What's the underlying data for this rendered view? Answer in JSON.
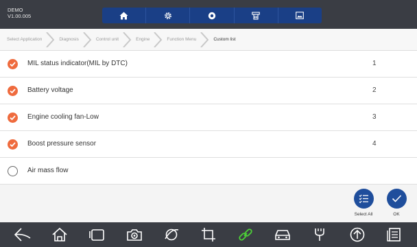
{
  "app": {
    "name": "DEMO",
    "version": "V1.00.005"
  },
  "toolbar": {
    "buttons": [
      {
        "icon": "home-icon"
      },
      {
        "icon": "gear-icon"
      },
      {
        "icon": "record-icon"
      },
      {
        "icon": "printer-icon"
      },
      {
        "icon": "image-icon"
      }
    ]
  },
  "breadcrumb": [
    "Select Application",
    "Diagnosis",
    "Control unit",
    "Engine",
    "Function Menu",
    "Custom list"
  ],
  "list": {
    "items": [
      {
        "label": "MIL status indicator(MIL by DTC)",
        "number": "1",
        "checked": true
      },
      {
        "label": "Battery voltage",
        "number": "2",
        "checked": true
      },
      {
        "label": "Engine cooling fan-Low",
        "number": "3",
        "checked": true
      },
      {
        "label": "Boost pressure sensor",
        "number": "4",
        "checked": true
      },
      {
        "label": "Air mass flow",
        "number": "",
        "checked": false
      }
    ]
  },
  "actions": {
    "select_all_label": "Select All",
    "ok_label": "OK"
  },
  "navbar": {
    "buttons": [
      "back-icon",
      "home-icon",
      "recent-apps-icon",
      "camera-icon",
      "browser-icon",
      "crop-icon",
      "link-icon",
      "car-icon",
      "tools-icon",
      "upload-icon",
      "report-icon"
    ]
  },
  "colors": {
    "topbar": "#3a3d44",
    "toolbar": "#1a3f86",
    "check_on": "#ef6b3e",
    "action_button": "#1f4e9c",
    "link_icon": "#4cd137"
  }
}
